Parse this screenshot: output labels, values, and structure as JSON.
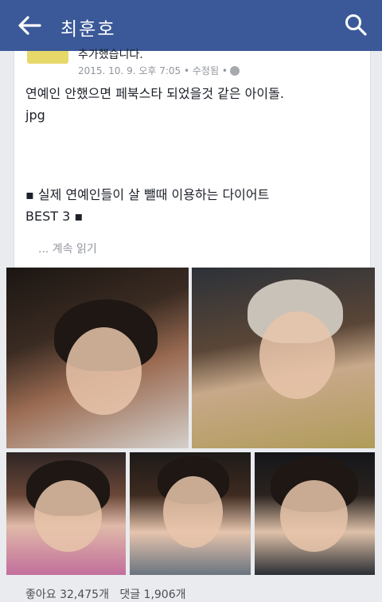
{
  "appbar": {
    "title": "최훈호"
  },
  "post": {
    "header_action": "추가했습니다.",
    "meta": "2015. 10. 9. 오후 7:05 • 수정됨 •",
    "text_line1": "연예인 안했으면 페북스타 되었을것 같은 아이돌.",
    "text_line2": "jpg",
    "highlight_line1": "▪ 실제 연예인들이 살 뺄때 이용하는 다이어트",
    "highlight_line2": "BEST 3 ▪",
    "see_more": "... 계속 읽기"
  },
  "footer": {
    "likes": "좋아요 32,475개",
    "comments": "댓글 1,906개"
  }
}
